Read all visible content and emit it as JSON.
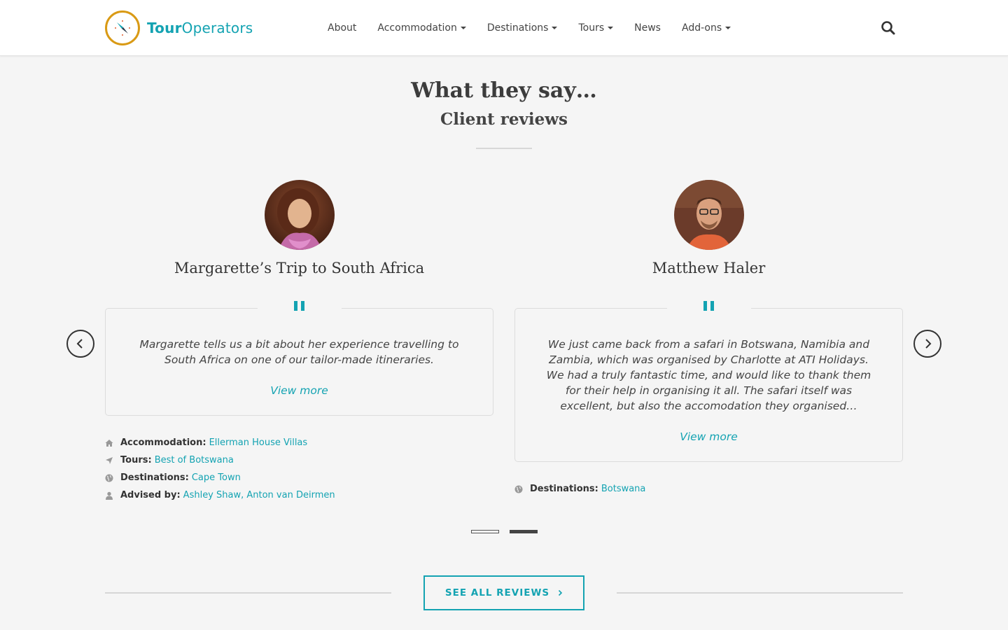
{
  "header": {
    "logo": {
      "bold": "Tour",
      "rest": "Operators",
      "icon": "compass-icon"
    },
    "nav": [
      {
        "label": "About",
        "dropdown": false
      },
      {
        "label": "Accommodation",
        "dropdown": true
      },
      {
        "label": "Destinations",
        "dropdown": true
      },
      {
        "label": "Tours",
        "dropdown": true
      },
      {
        "label": "News",
        "dropdown": false
      },
      {
        "label": "Add-ons",
        "dropdown": true
      }
    ],
    "search_icon": "search-icon"
  },
  "section": {
    "title": "What they say…",
    "subtitle": "Client reviews"
  },
  "reviews": [
    {
      "name": "Margarette’s Trip to South Africa",
      "quote": "Margarette tells us a bit about her experience travelling to South Africa on one of our tailor-made itineraries.",
      "view_more": "View more",
      "meta": {
        "accommodation_label": "Accommodation:",
        "accommodation_value": "Ellerman House Villas",
        "tours_label": "Tours:",
        "tours_value": "Best of Botswana",
        "destinations_label": "Destinations:",
        "destinations_value": "Cape Town",
        "advised_label": "Advised by:",
        "advised_value": "Ashley Shaw, Anton van Deirmen"
      }
    },
    {
      "name": "Matthew Haler",
      "quote": "We just came back from a safari in Botswana, Namibia and Zambia, which was organised by Charlotte at ATI Holidays. We had a truly fantastic time, and would like to thank them for their help in organising it all. The safari itself was excellent, but also the accomodation they organised…",
      "view_more": "View more",
      "meta": {
        "destinations_label": "Destinations:",
        "destinations_value": "Botswana"
      }
    }
  ],
  "carousel": {
    "pages": 2,
    "active_page": 2
  },
  "cta": {
    "label": "SEE ALL REVIEWS"
  },
  "colors": {
    "accent": "#14a3b2",
    "logo_ring": "#d99a15",
    "background": "#f5f5f5"
  }
}
